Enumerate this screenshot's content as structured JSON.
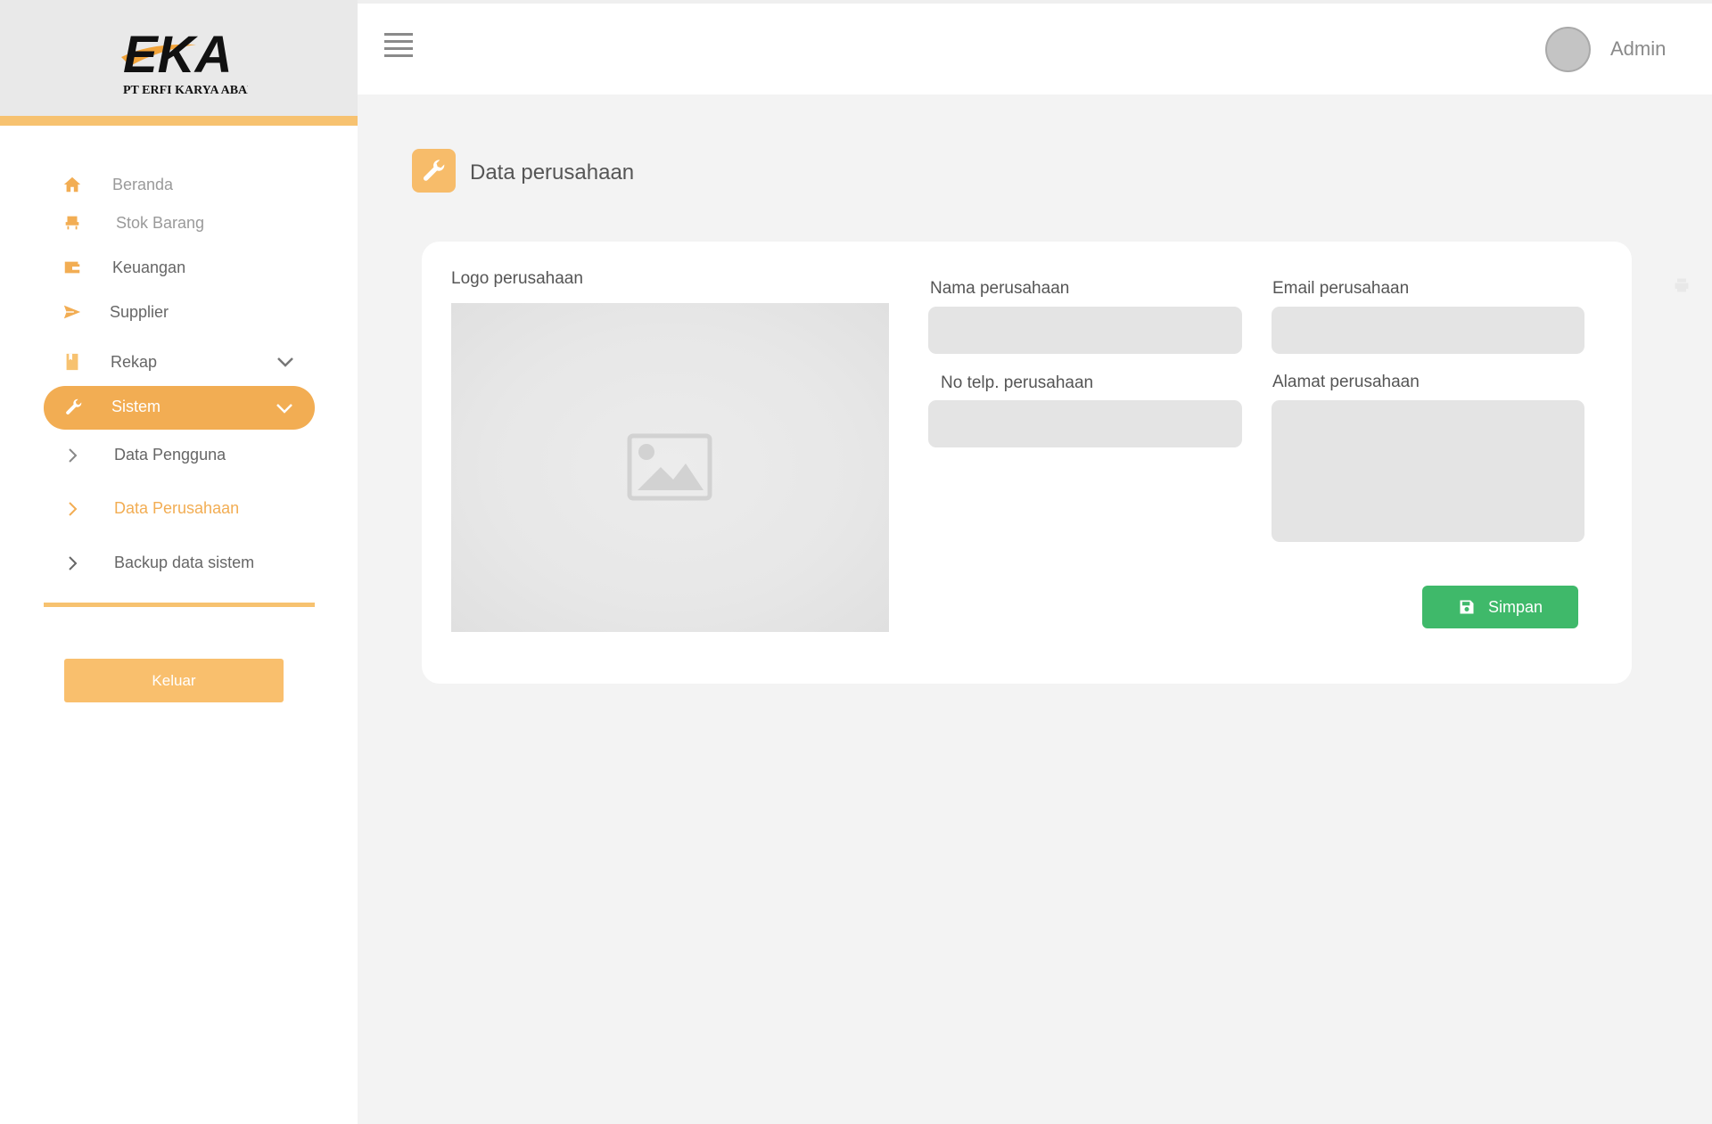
{
  "brand": {
    "logo_text": "EKA",
    "company_name": "PT ERFI KARYA ABADI"
  },
  "sidebar": {
    "items": [
      {
        "label": "Beranda",
        "icon": "home-icon"
      },
      {
        "label": "Stok Barang",
        "icon": "chair-icon"
      },
      {
        "label": "Keuangan",
        "icon": "wallet-icon"
      },
      {
        "label": "Supplier",
        "icon": "send-icon"
      },
      {
        "label": "Rekap",
        "icon": "book-icon"
      },
      {
        "label": "Sistem",
        "icon": "wrench-icon"
      }
    ],
    "sub_items": [
      {
        "label": "Data Pengguna"
      },
      {
        "label": "Data Perusahaan"
      },
      {
        "label": "Backup data sistem"
      }
    ],
    "logout_label": "Keluar",
    "accent": "#f2ad53"
  },
  "header": {
    "user_name": "Admin"
  },
  "page": {
    "title": "Data perusahaan"
  },
  "form": {
    "logo_label": "Logo perusahaan",
    "name_label": "Nama perusahaan",
    "email_label": "Email perusahaan",
    "phone_label": "No telp. perusahaan",
    "address_label": "Alamat perusahaan",
    "name_value": "",
    "email_value": "",
    "phone_value": "",
    "address_value": "",
    "save_label": "Simpan",
    "save_color": "#3fb96a"
  }
}
